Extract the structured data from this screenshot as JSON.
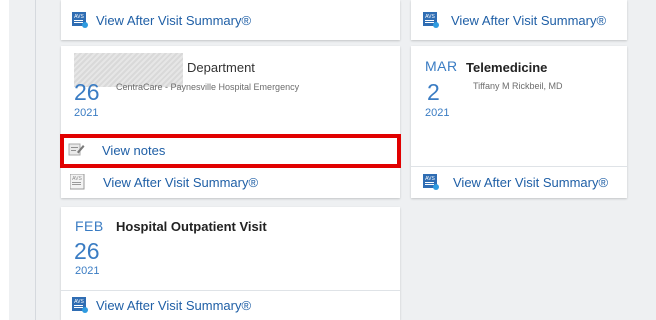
{
  "colors": {
    "accent": "#3a7cc3",
    "link": "#1f5fa6",
    "highlight": "#e10000"
  },
  "icons": {
    "avs": "avs-document-icon",
    "notes": "notes-pencil-icon"
  },
  "cards": {
    "top_left": {
      "avs_label": "View After Visit Summary®"
    },
    "top_right": {
      "avs_label": "View After Visit Summary®"
    },
    "dept": {
      "title": "Department",
      "subtitle": "CentraCare - Paynesville Hospital Emergency",
      "day": "26",
      "year": "2021",
      "notes_label": "View notes",
      "avs_label": "View After Visit Summary®"
    },
    "tele": {
      "month": "MAR",
      "day": "2",
      "year": "2021",
      "title": "Telemedicine",
      "subtitle": "Tiffany M Rickbeil, MD",
      "avs_label": "View After Visit Summary®"
    },
    "hosp": {
      "month": "FEB",
      "day": "26",
      "year": "2021",
      "title": "Hospital Outpatient Visit",
      "avs_label": "View After Visit Summary®"
    }
  }
}
